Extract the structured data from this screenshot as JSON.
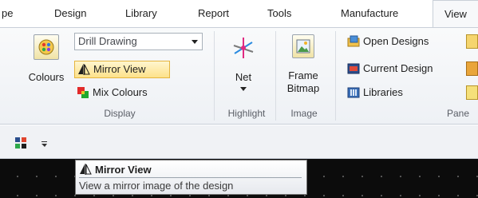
{
  "ribbon_tabs": [
    {
      "label": "pe"
    },
    {
      "label": "Design"
    },
    {
      "label": "Library"
    },
    {
      "label": "Report"
    },
    {
      "label": "Tools"
    },
    {
      "label": "Manufacture"
    },
    {
      "label": "View",
      "active": true
    }
  ],
  "display_group": {
    "label": "Display",
    "colours_label": "Colours",
    "view_select_value": "Drill Drawing",
    "mirror_view_label": "Mirror View",
    "mirror_view_selected": true,
    "mix_colours_label": "Mix Colours"
  },
  "highlight_group": {
    "label": "Highlight",
    "net_label": "Net"
  },
  "image_group": {
    "label": "Image",
    "frame_bitmap_line1": "Frame",
    "frame_bitmap_line2": "Bitmap"
  },
  "panels_group": {
    "label": "Pane",
    "open_designs_label": "Open Designs",
    "current_design_label": "Current Design",
    "libraries_label": "Libraries"
  },
  "tooltip": {
    "title": "Mirror View",
    "description": "View a mirror image of the design"
  },
  "icons": [
    "colours-icon",
    "mirror-view-icon",
    "mix-colours-icon",
    "net-highlight-icon",
    "frame-bitmap-icon",
    "open-designs-icon",
    "current-design-icon",
    "libraries-icon",
    "qat-app-icon",
    "qat-customize-icon"
  ],
  "colors": {
    "selected_fill": "#fde28a",
    "selected_border": "#e6b53e",
    "canvas_bg": "#0c0c0c"
  }
}
